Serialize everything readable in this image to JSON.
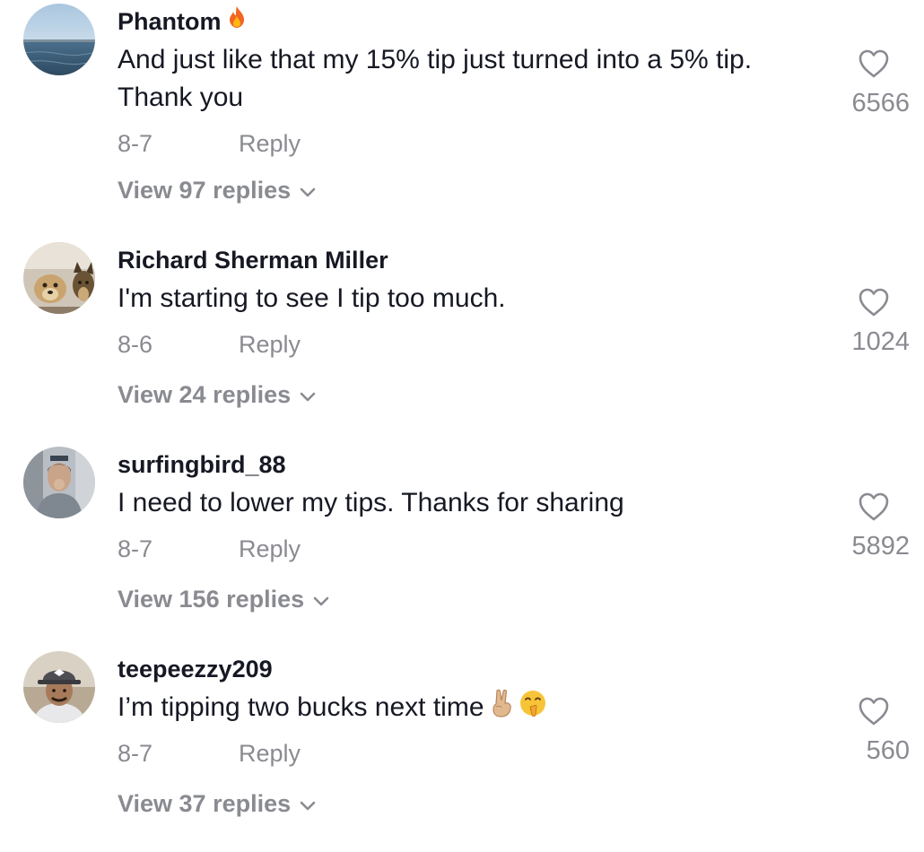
{
  "colors": {
    "text_primary": "#161823",
    "text_secondary": "#8a8b91",
    "background": "#ffffff"
  },
  "comments": [
    {
      "username": "Phantom",
      "username_emoji": "fire-icon",
      "text": "And just like that my 15% tip just turned into a 5% tip. Thank you",
      "date": "8-7",
      "reply_label": "Reply",
      "view_replies": "View 97 replies",
      "likes": "6566"
    },
    {
      "username": "Richard Sherman Miller",
      "text": "I'm starting to see I tip too much.",
      "date": "8-6",
      "reply_label": "Reply",
      "view_replies": "View 24 replies",
      "likes": "1024"
    },
    {
      "username": "surfingbird_88",
      "text": "I need to lower my tips. Thanks for sharing",
      "date": "8-7",
      "reply_label": "Reply",
      "view_replies": "View 156 replies",
      "likes": "5892"
    },
    {
      "username": "teepeezzy209",
      "text": "I’m tipping two bucks next time",
      "text_emojis": [
        "victory-hand-icon",
        "shushing-face-icon"
      ],
      "date": "8-7",
      "reply_label": "Reply",
      "view_replies": "View 37 replies",
      "likes": "560"
    }
  ]
}
